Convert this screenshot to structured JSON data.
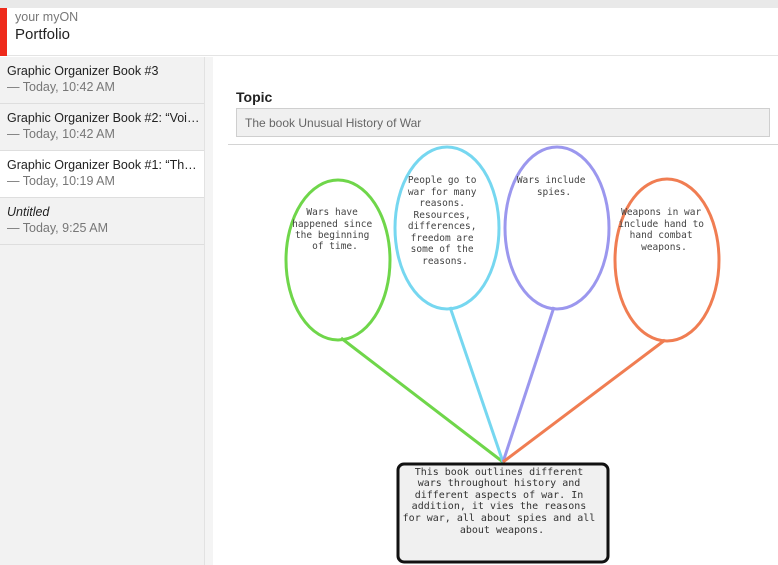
{
  "app": {
    "brand": "your myON",
    "section_title": "Portfolio",
    "accent_color": "#ee2a1b"
  },
  "sidebar": {
    "items": [
      {
        "title": "Graphic Organizer Book #3",
        "timestamp": "— Today, 10:42 AM",
        "italic": false,
        "selected": false
      },
      {
        "title": "Graphic Organizer Book #2: “Voi…",
        "timestamp": "— Today, 10:42 AM",
        "italic": false,
        "selected": false
      },
      {
        "title": "Graphic Organizer Book #1: “Th…",
        "timestamp": "— Today, 10:19 AM",
        "italic": false,
        "selected": true
      },
      {
        "title": "Untitled",
        "timestamp": "— Today, 9:25 AM",
        "italic": true,
        "selected": false
      }
    ]
  },
  "editor": {
    "topic_label": "Topic",
    "topic_value": "The book Unusual History of War"
  },
  "organizer": {
    "bubbles": [
      {
        "color": "#6fd64a",
        "lines": [
          "Wars have",
          "happened since",
          "the beginning",
          "of time."
        ]
      },
      {
        "color": "#76d7f0",
        "lines": [
          "People go to",
          "war for many",
          "reasons.",
          "Resources,",
          "differences,",
          "freedom are",
          "some of the",
          "reasons."
        ]
      },
      {
        "color": "#9b97ee",
        "lines": [
          "Wars include",
          "spies."
        ]
      },
      {
        "color": "#f07d52",
        "lines": [
          "Weapons in war",
          "include hand to",
          "hand combat",
          "weapons."
        ]
      }
    ],
    "center_box": {
      "lines": [
        "This book outlines different",
        "wars throughout history and",
        "different aspects of war. In",
        "addition, it vies the reasons",
        "for war, all about spies and all",
        "about weapons."
      ]
    }
  }
}
